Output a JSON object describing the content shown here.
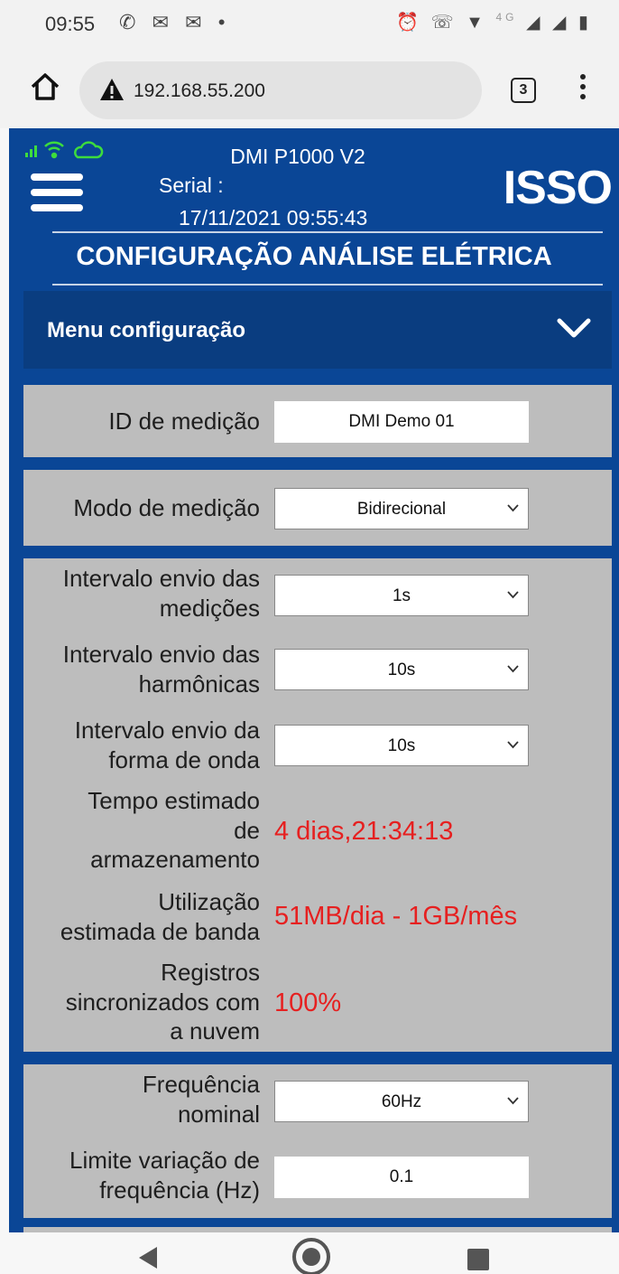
{
  "status_bar": {
    "time": "09:55",
    "left_icons": [
      "whatsapp-icon",
      "gmail-icon",
      "gmail-icon",
      "dot-icon"
    ],
    "right_icons": [
      "alarm-icon",
      "volte-icon",
      "wifi-icon",
      "4g-signal-icon",
      "signal-icon",
      "battery-icon"
    ],
    "network_label": "4G"
  },
  "browser": {
    "url": "192.168.55.200",
    "tab_count": "3"
  },
  "header": {
    "model": "DMI P1000 V2",
    "serial_label": "Serial :",
    "datetime": "17/11/2021 09:55:43",
    "logo": "ISSO",
    "page_title": "CONFIGURAÇÃO ANÁLISE ELÉTRICA"
  },
  "menu": {
    "label": "Menu configuração"
  },
  "form": {
    "measurement_id": {
      "label": "ID de medição",
      "value": "DMI Demo 01"
    },
    "measurement_mode": {
      "label": "Modo de medição",
      "value": "Bidirecional"
    },
    "interval_measurements": {
      "label_1": "Intervalo envio das",
      "label_2": "medições",
      "value": "1s"
    },
    "interval_harmonics": {
      "label_1": "Intervalo envio das",
      "label_2": "harmônicas",
      "value": "10s"
    },
    "interval_waveform": {
      "label_1": "Intervalo envio da",
      "label_2": "forma de onda",
      "value": "10s"
    },
    "storage_time": {
      "label_1": "Tempo estimado",
      "label_2": "de",
      "label_3": "armazenamento",
      "value": "4 dias,21:34:13"
    },
    "bandwidth": {
      "label_1": "Utilização",
      "label_2": "estimada de banda",
      "value": "51MB/dia - 1GB/mês"
    },
    "synced": {
      "label_1": "Registros",
      "label_2": "sincronizados com",
      "label_3": "a nuvem",
      "value": "100%"
    },
    "nominal_frequency": {
      "label_1": "Frequência",
      "label_2": "nominal",
      "value": "60Hz"
    },
    "frequency_limit": {
      "label_1": "Limite variação de",
      "label_2": "frequência (Hz)",
      "value": "0.1"
    }
  },
  "colors": {
    "app_background": "#0a4696",
    "panel": "#bdbdbd",
    "highlight_value": "#e62020"
  }
}
